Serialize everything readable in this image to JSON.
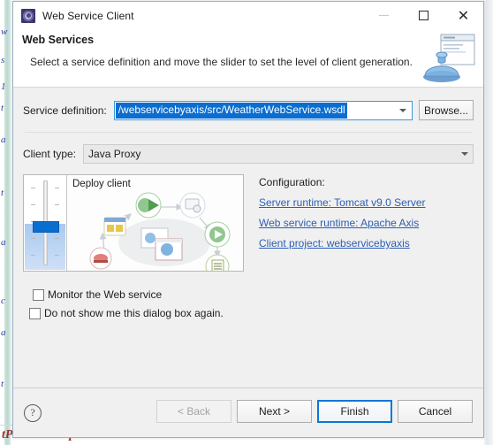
{
  "background": {
    "bottom_text": "tProvinceResponse",
    "gutter_chars": [
      "w",
      "s",
      "1",
      "t",
      "a",
      "t",
      "a",
      "c",
      "a",
      "t"
    ]
  },
  "dialog": {
    "title": "Web Service Client",
    "title_icon": "web-service-icon",
    "window_controls": {
      "minimize": "minimize-icon",
      "maximize": "maximize-icon",
      "close": "close-icon"
    },
    "header": {
      "title": "Web Services",
      "description": "Select a service definition and move the slider to set the level of client generation.",
      "banner_icon": "web-service-banner-icon"
    },
    "service_definition": {
      "label": "Service definition:",
      "value": "/webservicebyaxis/src/WeatherWebService.wsdl",
      "selected": true,
      "browse_label": "Browse...",
      "caret_icon": "chevron-down-icon"
    },
    "client_type": {
      "label": "Client type:",
      "value": "Java Proxy",
      "caret_icon": "chevron-down-icon"
    },
    "preview": {
      "stage_label": "Deploy client",
      "slider_position_percent": 50
    },
    "configuration": {
      "title": "Configuration:",
      "links": [
        {
          "label": "Server runtime: Tomcat v9.0 Server",
          "name": "server-runtime-link"
        },
        {
          "label": "Web service runtime: Apache Axis",
          "name": "web-service-runtime-link"
        },
        {
          "label": "Client project: webservicebyaxis",
          "name": "client-project-link"
        }
      ],
      "link_color": "#2b5fb5"
    },
    "options": [
      {
        "label": "Monitor the Web service",
        "checked": false,
        "name": "monitor-web-service-checkbox"
      },
      {
        "label": "Do not show me this dialog box again.",
        "checked": false,
        "name": "do-not-show-again-checkbox"
      }
    ],
    "footer": {
      "help_icon": "help-icon",
      "help_glyph": "?",
      "buttons": [
        {
          "label": "< Back",
          "state": "disabled",
          "name": "back-button"
        },
        {
          "label": "Next >",
          "state": "enabled",
          "name": "next-button"
        },
        {
          "label": "Finish",
          "state": "default",
          "name": "finish-button"
        },
        {
          "label": "Cancel",
          "state": "enabled",
          "name": "cancel-button"
        }
      ]
    }
  },
  "colors": {
    "accent": "#0a6ed1",
    "dialog_bg": "#f0f0f0",
    "link": "#2b5fb5",
    "focus_border": "#0a78d4"
  }
}
